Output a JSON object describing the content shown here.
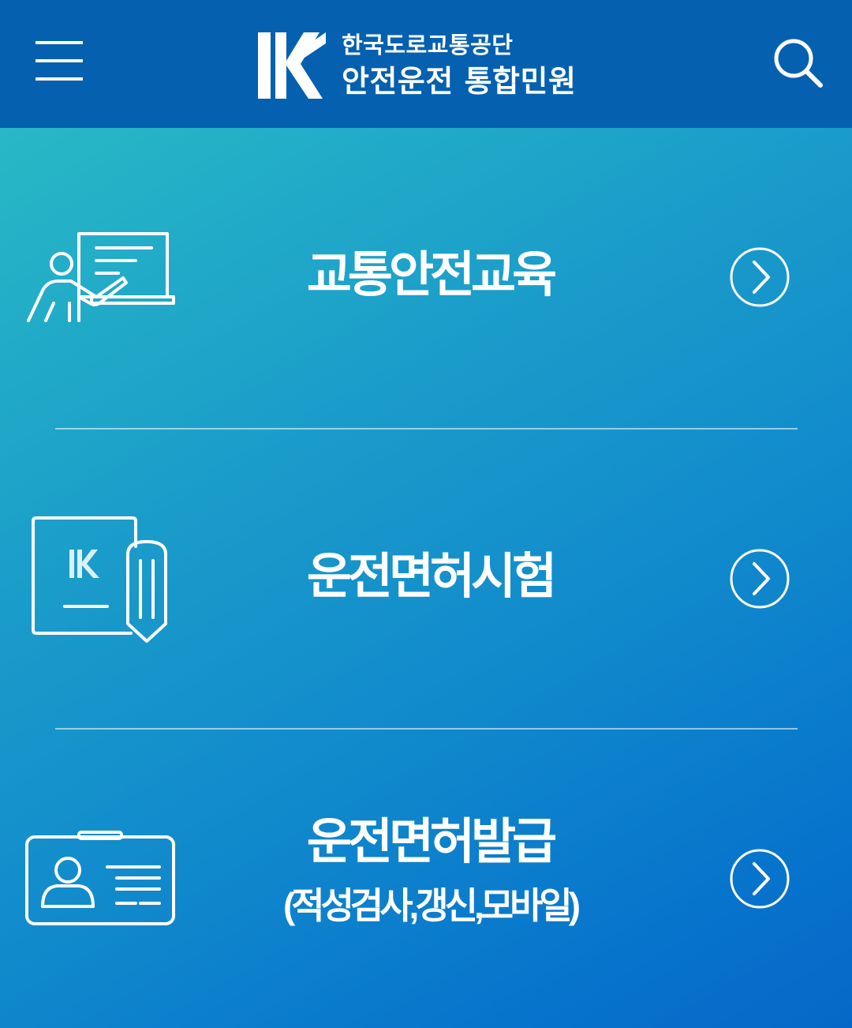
{
  "header": {
    "menu_icon": "hamburger-icon",
    "logo_sub": "한국도로교통공단",
    "logo_main": "안전운전 통합민원",
    "search_icon": "search-icon",
    "background": "#0560b0"
  },
  "items": [
    {
      "label": "교통안전교육",
      "sublabel": "",
      "icon": "teacher-board-icon"
    },
    {
      "label": "운전면허시험",
      "sublabel": "",
      "icon": "exam-pencil-icon"
    },
    {
      "label": "운전면허발급",
      "sublabel": "(적성검사,갱신,모바일)",
      "icon": "license-card-icon"
    }
  ],
  "colors": {
    "gradient_start": "#28b8c6",
    "gradient_end": "#0568c8",
    "text": "#ffffff"
  }
}
